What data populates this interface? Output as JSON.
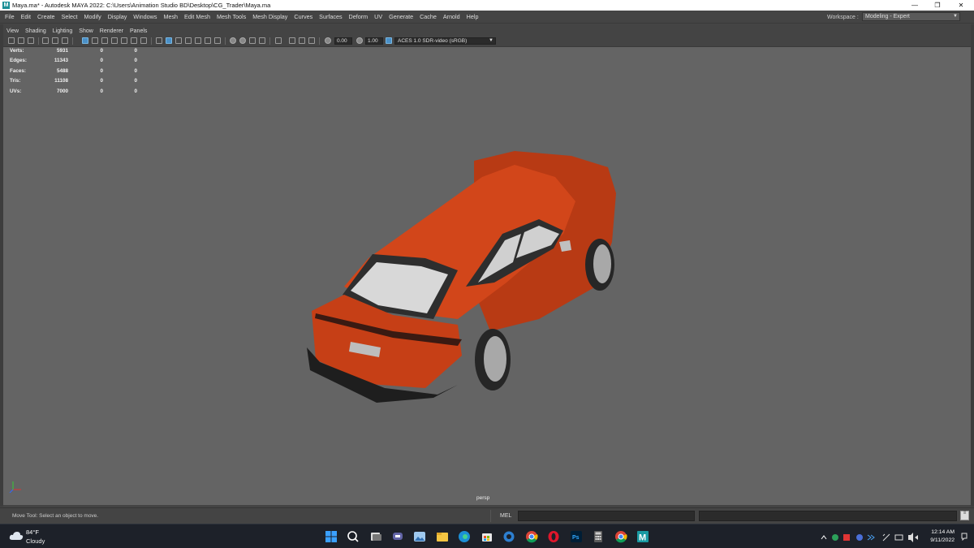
{
  "window": {
    "app_icon_letter": "M",
    "title": "Maya.ma* - Autodesk MAYA 2022: C:\\Users\\Animation Studio BD\\Desktop\\CG_Trader\\Maya.ma",
    "minimize": "—",
    "maximize": "❐",
    "close": "✕"
  },
  "menubar": {
    "items": [
      "File",
      "Edit",
      "Create",
      "Select",
      "Modify",
      "Display",
      "Windows",
      "Mesh",
      "Edit Mesh",
      "Mesh Tools",
      "Mesh Display",
      "Curves",
      "Surfaces",
      "Deform",
      "UV",
      "Generate",
      "Cache",
      "Arnold",
      "Help"
    ],
    "workspace_label": "Workspace :",
    "workspace_value": "Modeling - Expert"
  },
  "panel_menu": {
    "items": [
      "View",
      "Shading",
      "Lighting",
      "Show",
      "Renderer",
      "Panels"
    ]
  },
  "toolbar": {
    "exposure": "0.00",
    "gamma": "1.00",
    "color_space": "ACES 1.0 SDR-video (sRGB)"
  },
  "hud": {
    "rows": [
      {
        "label": "Verts:",
        "values": [
          "5931",
          "0",
          "0"
        ]
      },
      {
        "label": "Edges:",
        "values": [
          "11343",
          "0",
          "0"
        ]
      },
      {
        "label": "Faces:",
        "values": [
          "5488",
          "0",
          "0"
        ]
      },
      {
        "label": "Tris:",
        "values": [
          "11108",
          "0",
          "0"
        ]
      },
      {
        "label": "UVs:",
        "values": [
          "7000",
          "0",
          "0"
        ]
      }
    ]
  },
  "viewport": {
    "camera": "persp",
    "background_color": "#646464",
    "car_body_color": "#d2461a"
  },
  "helpline": {
    "help_text": "Move Tool: Select an object to move.",
    "command_lang": "MEL"
  },
  "taskbar": {
    "temperature": "84°F",
    "condition": "Cloudy",
    "time": "12:14 AM",
    "date": "9/11/2022",
    "apps": [
      "windows-start",
      "search",
      "task-view",
      "teams-chat",
      "photos",
      "file-explorer",
      "edge",
      "microsoft-store",
      "settings",
      "chrome",
      "opera",
      "photoshop",
      "calculator",
      "chrome-2",
      "maya"
    ]
  }
}
